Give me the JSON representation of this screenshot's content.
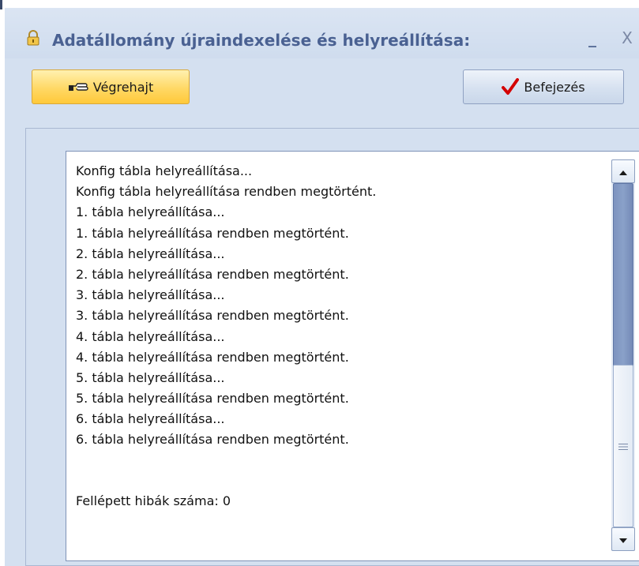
{
  "window": {
    "title": "Adatállomány újraindexelése és helyreállítása:",
    "minimize_label": "_",
    "close_label": "X",
    "icon": "padlock-icon"
  },
  "toolbar": {
    "execute_label": "Végrehajt",
    "execute_icon": "pointing-hand-icon",
    "finish_label": "Befejezés",
    "finish_icon": "checkmark-icon"
  },
  "log": {
    "lines": [
      "Konfig tábla helyreállítása...",
      "Konfig tábla helyreállítása rendben megtörtént.",
      "1. tábla helyreállítása...",
      "1. tábla helyreállítása rendben megtörtént.",
      "2. tábla helyreállítása...",
      "2. tábla helyreállítása rendben megtörtént.",
      "3. tábla helyreállítása...",
      "3. tábla helyreállítása rendben megtörtént.",
      "4. tábla helyreállítása...",
      "4. tábla helyreállítása rendben megtörtént.",
      "5. tábla helyreállítása...",
      "5. tábla helyreállítása rendben megtörtént.",
      "6. tábla helyreállítása...",
      "6. tábla helyreállítása rendben megtörtént."
    ],
    "summary": "Fellépett hibák száma: 0"
  },
  "colors": {
    "accent": "#4a6192",
    "execute_button": "#ffd865",
    "finish_checkmark": "#d40000",
    "scroll_thumb": "#8aa1c9"
  }
}
